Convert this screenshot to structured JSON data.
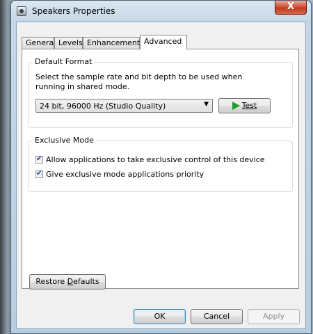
{
  "window": {
    "title": "Speakers Properties",
    "close_label": "X"
  },
  "tabs": [
    {
      "label": "General"
    },
    {
      "label": "Levels"
    },
    {
      "label": "Enhancements"
    },
    {
      "label": "Advanced"
    }
  ],
  "default_format": {
    "title": "Default Format",
    "description": "Select the sample rate and bit depth to be used when running in shared mode.",
    "selected_format": "24 bit, 96000 Hz (Studio Quality)",
    "test_label": "Test"
  },
  "exclusive_mode": {
    "title": "Exclusive Mode",
    "allow_label": "Allow applications to take exclusive control of this device",
    "priority_label": "Give exclusive mode applications priority"
  },
  "restore_label_pre": "Restore ",
  "restore_label_key": "D",
  "restore_label_post": "efaults",
  "buttons": {
    "ok": "OK",
    "cancel": "Cancel",
    "apply": "Apply"
  }
}
